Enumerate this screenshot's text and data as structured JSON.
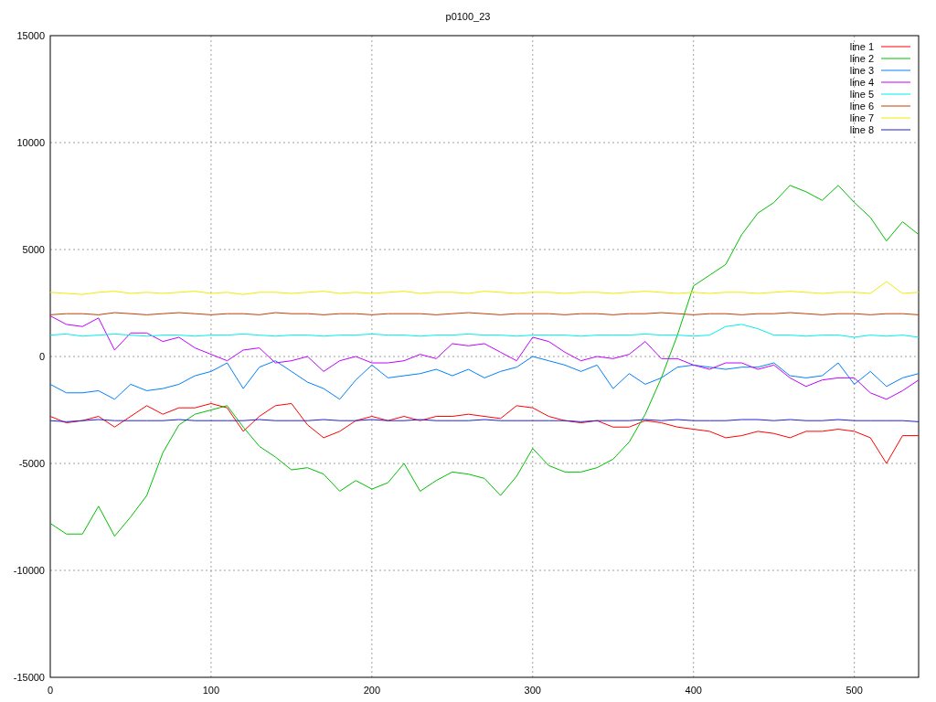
{
  "chart": {
    "chart_data": {
      "type": "line",
      "title": "p0100_23",
      "x": [
        0,
        10,
        20,
        30,
        40,
        50,
        60,
        70,
        80,
        90,
        100,
        110,
        120,
        130,
        140,
        150,
        160,
        170,
        180,
        190,
        200,
        210,
        220,
        230,
        240,
        250,
        260,
        270,
        280,
        290,
        300,
        310,
        320,
        330,
        340,
        350,
        360,
        370,
        380,
        390,
        400,
        410,
        420,
        430,
        440,
        450,
        460,
        470,
        480,
        490,
        500,
        510,
        520,
        530,
        540
      ],
      "xlim": [
        0,
        540
      ],
      "ylim": [
        -15000,
        15000
      ],
      "xticks": [
        0,
        100,
        200,
        300,
        400,
        500
      ],
      "yticks": [
        -15000,
        -10000,
        -5000,
        0,
        5000,
        10000,
        15000
      ],
      "grid": true,
      "legend": true,
      "series": [
        {
          "name": "line 1",
          "color": "#ff0000",
          "values": [
            -2800,
            -3100,
            -3000,
            -2800,
            -3300,
            -2800,
            -2300,
            -2700,
            -2400,
            -2400,
            -2200,
            -2400,
            -3500,
            -2800,
            -2300,
            -2200,
            -3200,
            -3800,
            -3500,
            -3000,
            -2800,
            -3000,
            -2800,
            -3000,
            -2800,
            -2800,
            -2700,
            -2800,
            -2900,
            -2300,
            -2400,
            -2800,
            -3000,
            -3100,
            -3000,
            -3300,
            -3300,
            -3000,
            -3100,
            -3300,
            -3400,
            -3500,
            -3800,
            -3700,
            -3500,
            -3600,
            -3800,
            -3500,
            -3500,
            -3400,
            -3500,
            -3800,
            -5000,
            -3700,
            -3700
          ]
        },
        {
          "name": "line 2",
          "color": "#00c000",
          "values": [
            -7800,
            -8300,
            -8300,
            -7000,
            -8400,
            -7500,
            -6500,
            -4500,
            -3200,
            -2700,
            -2500,
            -2300,
            -3300,
            -4200,
            -4700,
            -5300,
            -5200,
            -5500,
            -6300,
            -5800,
            -6200,
            -5900,
            -5000,
            -6300,
            -5800,
            -5400,
            -5500,
            -5700,
            -6500,
            -5600,
            -4300,
            -5100,
            -5400,
            -5400,
            -5200,
            -4800,
            -4000,
            -2700,
            -1000,
            1000,
            3300,
            3800,
            4300,
            5700,
            6700,
            7200,
            8000,
            7700,
            7300,
            8000,
            7200,
            6500,
            5400,
            6300,
            5700
          ]
        },
        {
          "name": "line 3",
          "color": "#0080ff",
          "values": [
            -1300,
            -1700,
            -1700,
            -1600,
            -2000,
            -1300,
            -1600,
            -1500,
            -1300,
            -900,
            -700,
            -300,
            -1500,
            -500,
            -200,
            -700,
            -1200,
            -1500,
            -2000,
            -1100,
            -400,
            -1000,
            -900,
            -800,
            -600,
            -900,
            -600,
            -1000,
            -700,
            -500,
            0,
            -200,
            -400,
            -700,
            -400,
            -1500,
            -800,
            -1300,
            -1000,
            -500,
            -400,
            -500,
            -600,
            -500,
            -500,
            -300,
            -900,
            -1000,
            -900,
            -300,
            -1300,
            -700,
            -1400,
            -1000,
            -800
          ]
        },
        {
          "name": "line 4",
          "color": "#c000ff",
          "values": [
            1900,
            1500,
            1400,
            1800,
            300,
            1100,
            1100,
            700,
            900,
            400,
            100,
            -200,
            300,
            400,
            -300,
            -200,
            0,
            -700,
            -200,
            0,
            -300,
            -300,
            -200,
            100,
            -100,
            600,
            500,
            600,
            200,
            -200,
            900,
            700,
            200,
            -200,
            0,
            -100,
            100,
            700,
            -100,
            -100,
            -400,
            -600,
            -300,
            -300,
            -600,
            -400,
            -1000,
            -1400,
            -1100,
            -1000,
            -1000,
            -1700,
            -2000,
            -1600,
            -1100
          ]
        },
        {
          "name": "line 5",
          "color": "#00eeee",
          "values": [
            1000,
            1050,
            950,
            1000,
            1050,
            1000,
            950,
            1000,
            1000,
            950,
            1000,
            1000,
            1050,
            1000,
            950,
            1000,
            1000,
            950,
            1000,
            1000,
            1050,
            1000,
            1000,
            950,
            1000,
            1000,
            1050,
            1000,
            1000,
            950,
            1000,
            1000,
            1000,
            950,
            1000,
            1000,
            1000,
            1050,
            1000,
            1000,
            950,
            1000,
            1400,
            1500,
            1300,
            1000,
            1000,
            950,
            1000,
            1000,
            900,
            1000,
            950,
            1000,
            900
          ]
        },
        {
          "name": "line 6",
          "color": "#c04000",
          "values": [
            1950,
            2000,
            2000,
            1950,
            2050,
            2000,
            1950,
            2000,
            2050,
            2000,
            1950,
            2000,
            2000,
            1950,
            2050,
            2000,
            2000,
            1950,
            2000,
            2000,
            1950,
            2000,
            2000,
            2000,
            1950,
            2000,
            2050,
            2000,
            1950,
            2000,
            2000,
            2000,
            1950,
            2000,
            2000,
            1950,
            2000,
            2000,
            2050,
            2000,
            1950,
            2000,
            2000,
            1950,
            2000,
            2000,
            2050,
            2000,
            1950,
            2000,
            2000,
            1950,
            2000,
            2000,
            1950
          ]
        },
        {
          "name": "line 7",
          "color": "#eeee00",
          "values": [
            3000,
            2950,
            2900,
            3000,
            3050,
            2950,
            3000,
            2950,
            3000,
            3050,
            2950,
            3000,
            2900,
            3000,
            3000,
            2950,
            3000,
            3050,
            2950,
            3000,
            2950,
            3000,
            3050,
            2950,
            3000,
            3000,
            2950,
            3050,
            3000,
            2950,
            3000,
            3000,
            2950,
            3000,
            3000,
            2950,
            3000,
            3050,
            3000,
            2950,
            3000,
            2950,
            3000,
            3000,
            2950,
            3000,
            3050,
            3000,
            2950,
            3000,
            3000,
            2950,
            3500,
            2950,
            3000
          ]
        },
        {
          "name": "line 8",
          "color": "#2020d0",
          "values": [
            -3000,
            -3050,
            -3000,
            -2950,
            -3000,
            -3000,
            -3000,
            -3000,
            -2950,
            -3000,
            -3000,
            -3000,
            -3000,
            -2950,
            -3000,
            -3000,
            -3000,
            -2950,
            -3000,
            -3000,
            -2950,
            -3000,
            -3000,
            -2950,
            -3000,
            -3000,
            -3000,
            -2950,
            -3000,
            -3000,
            -3000,
            -3000,
            -3000,
            -3050,
            -3000,
            -3000,
            -3000,
            -2950,
            -3000,
            -2950,
            -3000,
            -3000,
            -3000,
            -2950,
            -2950,
            -3000,
            -2950,
            -3000,
            -3000,
            -2950,
            -3000,
            -3000,
            -3000,
            -3000,
            -3050
          ]
        }
      ]
    }
  }
}
